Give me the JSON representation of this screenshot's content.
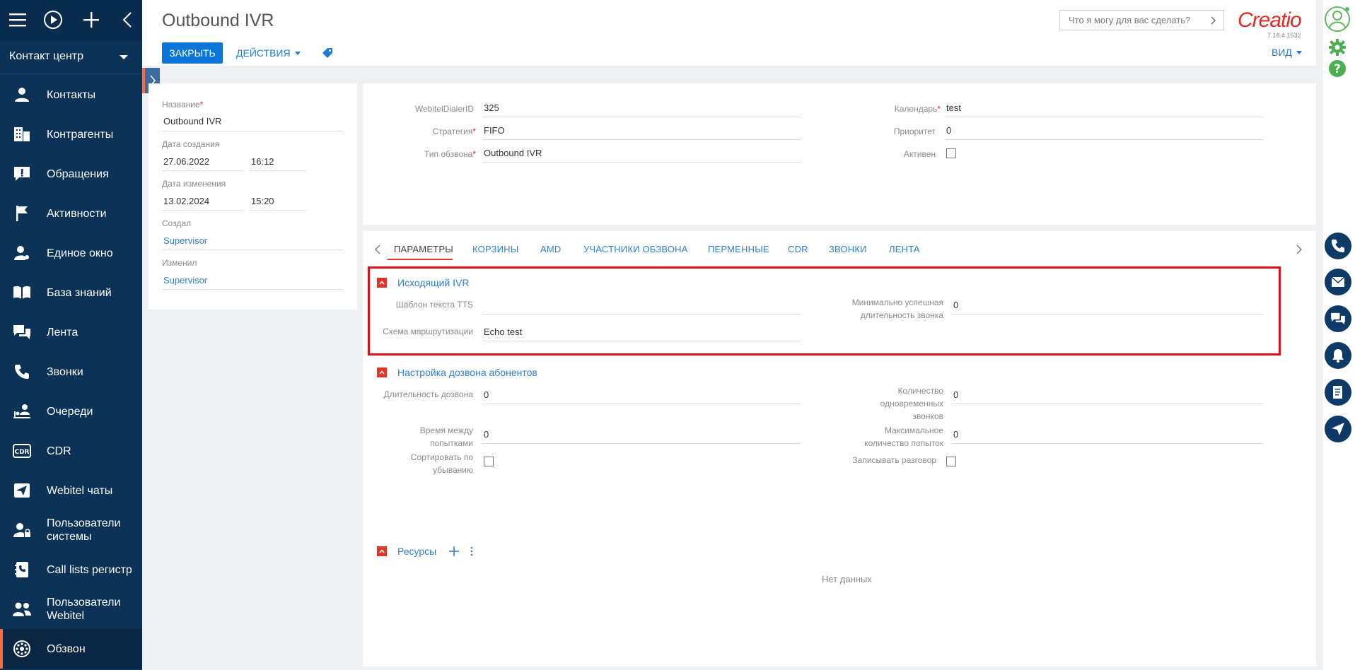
{
  "sidebar": {
    "workplace": "Контакт центр",
    "items": [
      {
        "label": "Контакты",
        "icon": "person-icon"
      },
      {
        "label": "Контрагенты",
        "icon": "building-icon"
      },
      {
        "label": "Обращения",
        "icon": "exclamation-icon"
      },
      {
        "label": "Активности",
        "icon": "flag-icon"
      },
      {
        "label": "Единое окно",
        "icon": "user-settings-icon"
      },
      {
        "label": "База знаний",
        "icon": "book-icon"
      },
      {
        "label": "Лента",
        "icon": "chat-icon"
      },
      {
        "label": "Звонки",
        "icon": "phone-icon"
      },
      {
        "label": "Очереди",
        "icon": "queue-icon"
      },
      {
        "label": "CDR",
        "icon": "cdr-icon"
      },
      {
        "label": "Webitel чаты",
        "icon": "paper-plane-icon"
      },
      {
        "label": "Пользователи системы",
        "icon": "user-lock-icon"
      },
      {
        "label": "Call lists регистр",
        "icon": "phone-list-icon"
      },
      {
        "label": "Пользователи Webitel",
        "icon": "users-icon"
      },
      {
        "label": "Обзвон",
        "icon": "dialer-icon"
      }
    ]
  },
  "header": {
    "title": "Outbound IVR",
    "close_label": "ЗАКРЫТЬ",
    "actions_label": "ДЕЙСТВИЯ",
    "search_placeholder": "Что я могу для вас сделать?",
    "logo": "Creatio",
    "version": "7.18.4.1532",
    "view_label": "ВИД"
  },
  "left_panel": {
    "name_label": "Название",
    "name_value": "Outbound IVR",
    "created_label": "Дата создания",
    "created_date": "27.06.2022",
    "created_time": "16:12",
    "modified_label": "Дата изменения",
    "modified_date": "13.02.2024",
    "modified_time": "15:20",
    "created_by_label": "Создал",
    "created_by": "Supervisor",
    "modified_by_label": "Изменил",
    "modified_by": "Supervisor"
  },
  "main_fields": {
    "dialer_id_label": "WebitelDialerID",
    "dialer_id": "325",
    "strategy_label": "Стратегия",
    "strategy": "FIFO",
    "dial_type_label": "Тип обзвона",
    "dial_type": "Outbound IVR",
    "calendar_label": "Календарь",
    "calendar": "test",
    "priority_label": "Приоритет",
    "priority": "0",
    "active_label": "Активен"
  },
  "tabs": [
    "ПАРАМЕТРЫ",
    "КОРЗИНЫ",
    "AMD",
    "УЧАСТНИКИ ОБЗВОНА",
    "ПЕРМЕННЫЕ",
    "CDR",
    "ЗВОНКИ",
    "ЛЕНТА"
  ],
  "ivr_group": {
    "title": "Исходящий IVR",
    "tts_label": "Шаблон текста TTS",
    "tts_value": "",
    "routing_label": "Схема маршрутизации",
    "routing_value": "Echo test",
    "min_duration_label_1": "Минимально успешная",
    "min_duration_label_2": "длительность звонка",
    "min_duration_value": "0"
  },
  "dial_group": {
    "title": "Настройка дозвона абонентов",
    "dial_duration_label": "Длительность дозвона",
    "dial_duration_value": "0",
    "retry_interval_label_1": "Время между",
    "retry_interval_label_2": "попытками",
    "retry_interval_value": "0",
    "sort_desc_label_1": "Сортировать по",
    "sort_desc_label_2": "убыванию",
    "concurrent_label_1": "Количество",
    "concurrent_label_2": "одновременных",
    "concurrent_label_3": "звонков",
    "concurrent_value": "0",
    "max_attempts_label_1": "Максимальное",
    "max_attempts_label_2": "количество попыток",
    "max_attempts_value": "0",
    "record_label": "Записывать разговор"
  },
  "resources_group": {
    "title": "Ресурсы",
    "empty_text": "Нет данных"
  },
  "colors": {
    "sidebar_bg": "#0c3258",
    "accent": "#0b75d8",
    "brand_red": "#e52b20",
    "highlight": "#e10f13"
  }
}
